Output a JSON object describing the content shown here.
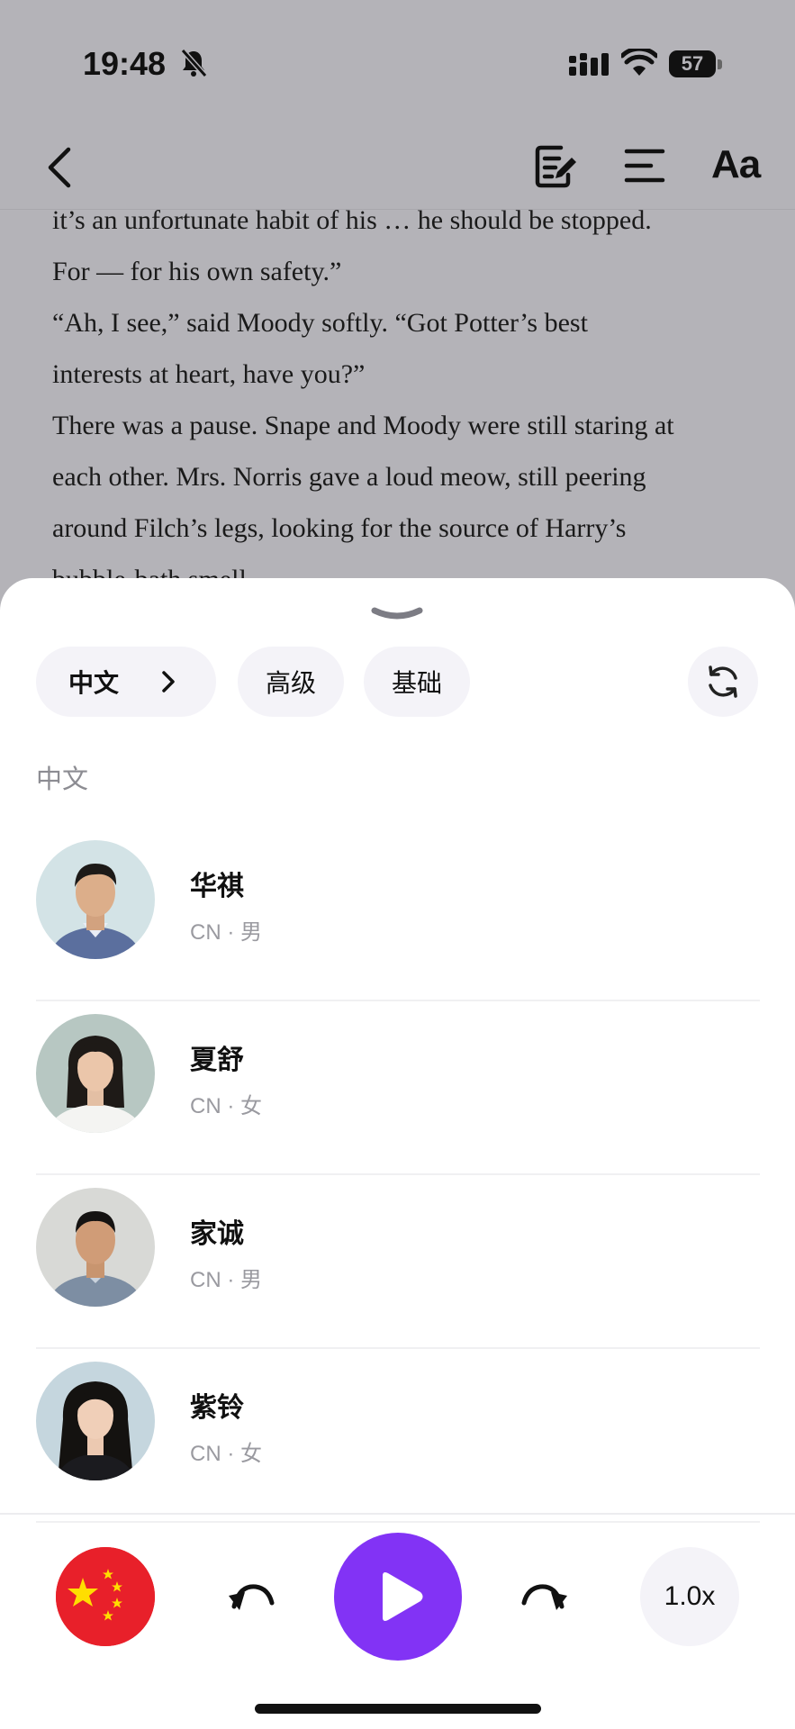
{
  "status_bar": {
    "time": "19:48",
    "battery_percent": "57"
  },
  "reader": {
    "lines": [
      "it’s an unfortunate habit of his … he should be stopped.",
      "For — for his own safety.”",
      "“Ah, I see,” said Moody softly. “Got Potter’s best",
      "interests at heart, have you?”",
      "There was a pause. Snape and Moody were still staring at",
      "each other. Mrs. Norris gave a loud meow, still peering",
      "around Filch’s legs, looking for the source of Harry’s",
      "bubble-bath smell."
    ],
    "font_button": "Aa"
  },
  "sheet": {
    "filters": {
      "language": "中文",
      "advanced": "高级",
      "basic": "基础"
    },
    "section_title": "中文",
    "voices": [
      {
        "name": "华祺",
        "region": "CN",
        "gender": "男"
      },
      {
        "name": "夏舒",
        "region": "CN",
        "gender": "女"
      },
      {
        "name": "家诚",
        "region": "CN",
        "gender": "男"
      },
      {
        "name": "紫铃",
        "region": "CN",
        "gender": "女"
      }
    ]
  },
  "player": {
    "speed": "1.0x"
  },
  "icons": [
    "bell-slash-icon",
    "signal-icon",
    "wifi-icon",
    "battery-icon",
    "back-icon",
    "notes-icon",
    "toc-icon",
    "chevron-down-icon",
    "chevron-right-icon",
    "refresh-icon",
    "china-flag-icon",
    "rewind-icon",
    "play-icon",
    "forward-icon"
  ],
  "colors": {
    "accent": "#8233f5",
    "chip_bg": "#f4f3f8",
    "flag_red": "#e8202a",
    "flag_star": "#ffde00"
  }
}
